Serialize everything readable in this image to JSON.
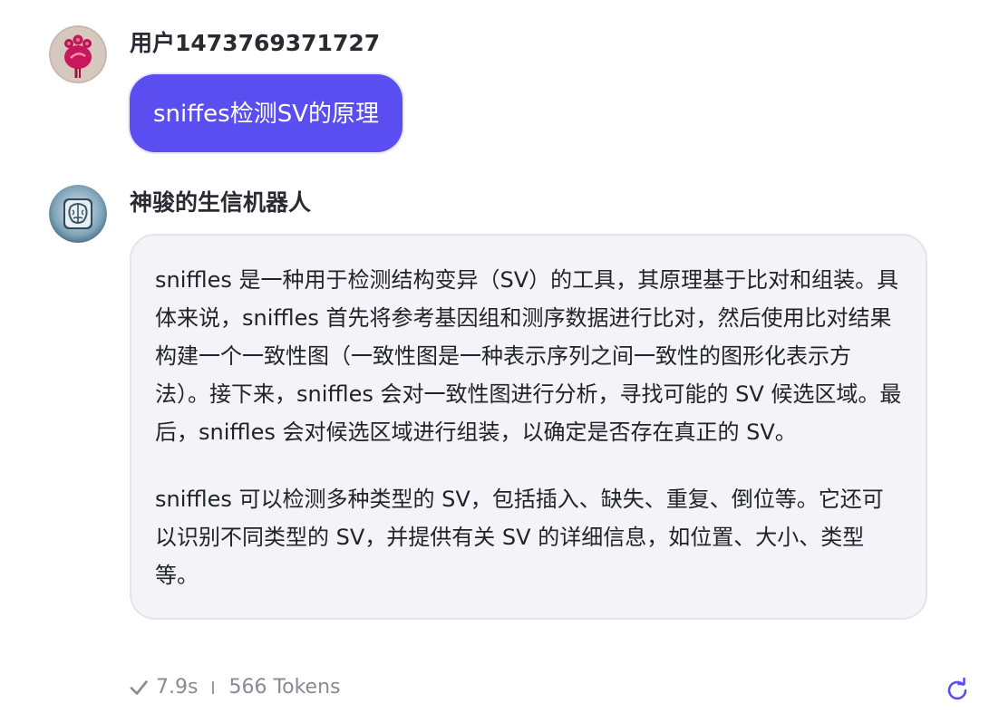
{
  "user": {
    "name": "用户1473769371727",
    "message": "sniffes检测SV的原理",
    "avatar_icon": "pink-flower-avatar-icon"
  },
  "bot": {
    "name": "神骏的生信机器人",
    "avatar_icon": "brain-robot-avatar-icon",
    "paragraphs": [
      "sniffles 是一种用于检测结构变异（SV）的工具，其原理基于比对和组装。具体来说，sniffles 首先将参考基因组和测序数据进行比对，然后使用比对结果构建一个一致性图（一致性图是一种表示序列之间一致性的图形化表示方法）。接下来，sniffles 会对一致性图进行分析，寻找可能的 SV 候选区域。最后，sniffles 会对候选区域进行组装，以确定是否存在真正的 SV。",
      "sniffles 可以检测多种类型的 SV，包括插入、缺失、重复、倒位等。它还可以识别不同类型的 SV，并提供有关 SV 的详细信息，如位置、大小、类型等。"
    ]
  },
  "meta": {
    "duration": "7.9s",
    "tokens": "566 Tokens",
    "status_icon": "check-icon",
    "regenerate_icon": "refresh-icon"
  },
  "colors": {
    "accent": "#5b4ef0",
    "bubble_bg": "#f4f4f8",
    "meta_text": "#8a8a94"
  }
}
